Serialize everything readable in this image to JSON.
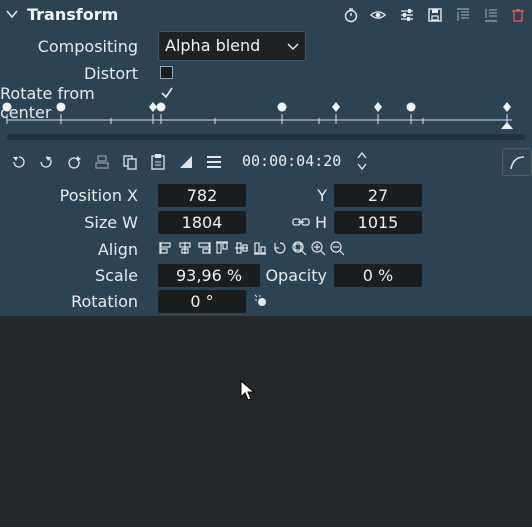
{
  "panel": {
    "title": "Transform",
    "header_icons": [
      "stopwatch-icon",
      "eye-icon",
      "sliders-icon",
      "save-icon",
      "align-top-icon",
      "align-bottom-icon",
      "trash-icon"
    ]
  },
  "compositing": {
    "label": "Compositing",
    "value": "Alpha blend"
  },
  "distort": {
    "label": "Distort",
    "checked": false
  },
  "rotate_center": {
    "label": "Rotate from center",
    "checked": true
  },
  "timecode": "00:00:04:20",
  "position": {
    "label": "Position X",
    "x": "782",
    "y_label": "Y",
    "y": "27"
  },
  "size": {
    "label": "Size W",
    "w": "1804",
    "h_label": "H",
    "h": "1015"
  },
  "align": {
    "label": "Align"
  },
  "scale": {
    "label": "Scale",
    "value": "93,96 %"
  },
  "opacity": {
    "label": "Opacity",
    "value": "0 %"
  },
  "rotation": {
    "label": "Rotation",
    "value": "0 °"
  },
  "colors": {
    "panel_bg": "#2c4354",
    "field_bg": "#1b1e21",
    "body_bg": "#25282b"
  }
}
